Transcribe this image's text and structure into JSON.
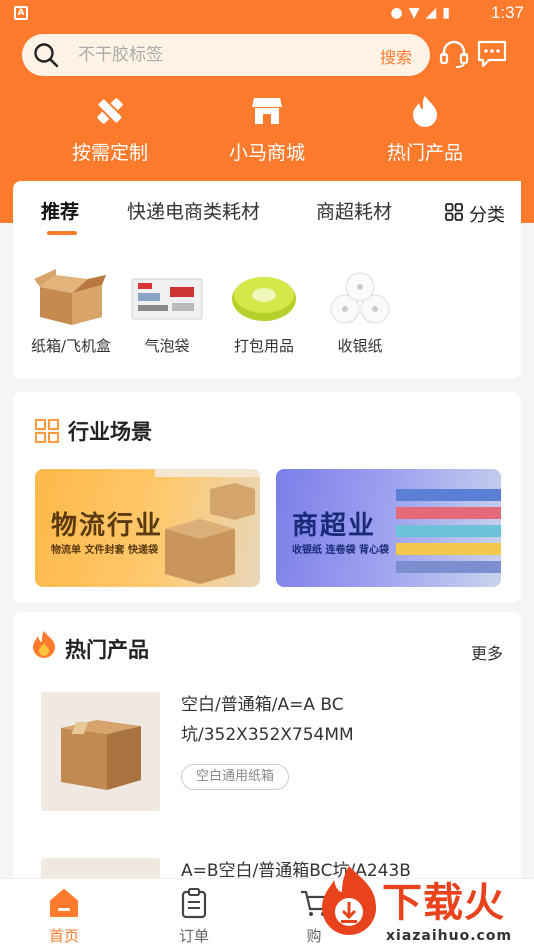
{
  "status_bar": {
    "time": "1:37"
  },
  "search": {
    "placeholder": "不干胶标签",
    "button_label": "搜索"
  },
  "quick_links": [
    {
      "label": "按需定制",
      "icon": "pencil-ruler-icon"
    },
    {
      "label": "小马商城",
      "icon": "store-icon"
    },
    {
      "label": "热门产品",
      "icon": "flame-icon"
    }
  ],
  "tabs": [
    "推荐",
    "快递电商类耗材",
    "商超耗材"
  ],
  "category_button": "分类",
  "categories": [
    {
      "label": "纸箱/飞机盒",
      "icon": "carton-box-image"
    },
    {
      "label": "气泡袋",
      "icon": "bubble-bag-image"
    },
    {
      "label": "打包用品",
      "icon": "strapping-roll-image"
    },
    {
      "label": "收银纸",
      "icon": "receipt-paper-roll-image"
    }
  ],
  "industry": {
    "title": "行业场景",
    "banners": [
      {
        "title": "物流行业",
        "subtitle": "物流单 文件封套 快递袋"
      },
      {
        "title": "商超业",
        "subtitle": "收银纸 连卷袋 背心袋"
      }
    ]
  },
  "hot": {
    "title": "热门产品",
    "more_label": "更多",
    "products": [
      {
        "title": "空白/普通箱/A=A BC坑/352X352X754MM",
        "tag": "空白通用纸箱"
      },
      {
        "title": "A=B空白/普通箱BC坑/A243B"
      }
    ]
  },
  "bottom_nav": [
    {
      "label": "首页",
      "icon": "home-icon",
      "active": true
    },
    {
      "label": "订单",
      "icon": "clipboard-icon",
      "active": false
    },
    {
      "label": "购",
      "icon": "cart-icon",
      "active": false
    }
  ],
  "watermark": {
    "text": "下载火",
    "url": "xiazaihuo.com"
  },
  "colors": {
    "brand": "#fe7b2d",
    "tag_border": "#cccccc"
  }
}
